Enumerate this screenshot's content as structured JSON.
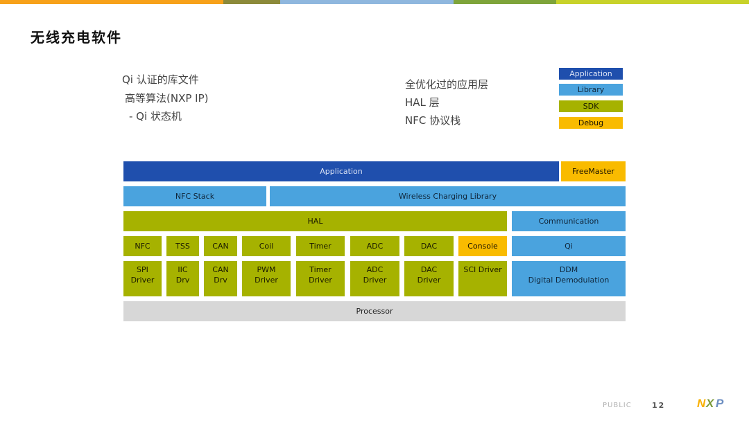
{
  "title": "无线充电软件",
  "notes_left": [
    "Qi 认证的库文件",
    "高等算法(NXP IP)",
    "- Qi 状态机"
  ],
  "notes_right": [
    "全优化过的应用层",
    "HAL 层",
    "NFC 协议栈"
  ],
  "legend": [
    {
      "label": "Application",
      "color": "#1f4fad"
    },
    {
      "label": "Library",
      "color": "#4aa3de"
    },
    {
      "label": "SDK",
      "color": "#a6b200"
    },
    {
      "label": "Debug",
      "color": "#f9bb00"
    }
  ],
  "blocks": {
    "application": "Application",
    "freemaster": "FreeMaster",
    "nfc_stack": "NFC Stack",
    "wcl": "Wireless Charging Library",
    "hal": "HAL",
    "communication": "Communication",
    "nfc": "NFC",
    "tss": "TSS",
    "can": "CAN",
    "coil": "Coil",
    "timer": "Timer",
    "adc": "ADC",
    "dac": "DAC",
    "console": "Console",
    "qi": "Qi",
    "spi_driver": "SPI\nDriver",
    "iic_drv": "IIC\nDrv",
    "can_drv": "CAN\nDrv",
    "pwm_driver": "PWM\nDriver",
    "timer_driver": "Timer\nDriver",
    "adc_driver": "ADC\nDriver",
    "dac_driver": "DAC\nDriver",
    "sci_driver": "SCI Driver",
    "ddm": "DDM\nDigital Demodulation",
    "processor": "Processor"
  },
  "footer": {
    "public": "PUBLIC",
    "page": "12",
    "logo": "NXP"
  },
  "colors": {
    "top_bar": [
      "#f7a11a",
      "#8c8a3a",
      "#8fb7de",
      "#7ea43a",
      "#c8d22a"
    ]
  }
}
